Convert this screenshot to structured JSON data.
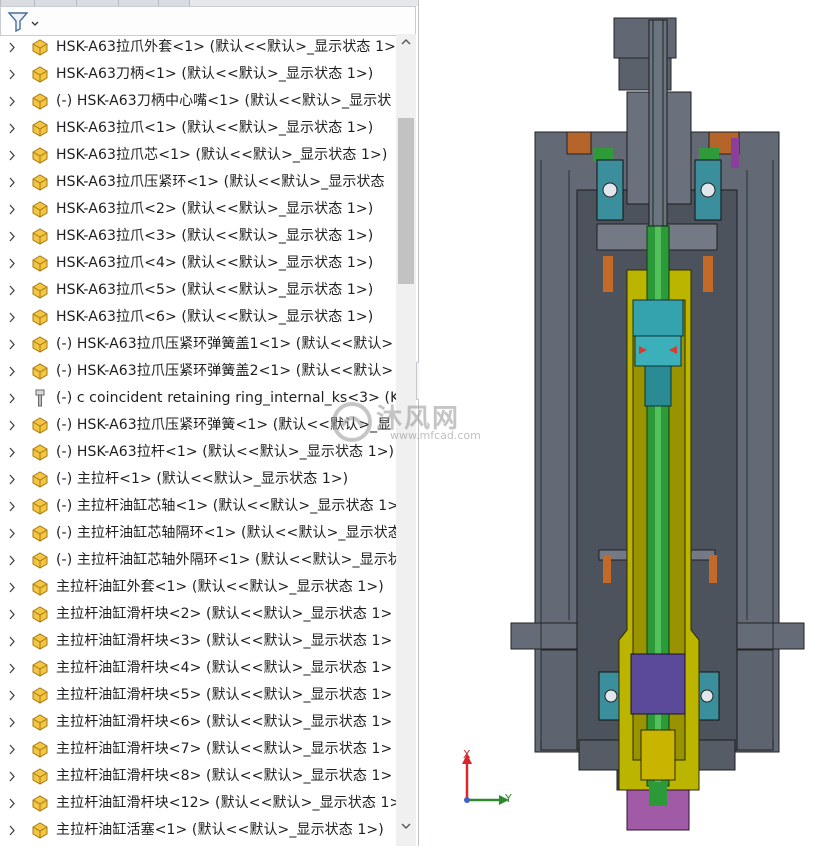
{
  "tree": {
    "filter_tooltip": "",
    "items": [
      {
        "icon": "part-icon",
        "label": "HSK-A63拉爪外套<1> (默认<<默认>_显示状态 1>"
      },
      {
        "icon": "part-icon",
        "label": "HSK-A63刀柄<1> (默认<<默认>_显示状态 1>)"
      },
      {
        "icon": "part-icon",
        "label": "(-) HSK-A63刀柄中心嘴<1> (默认<<默认>_显示状"
      },
      {
        "icon": "part-icon",
        "label": "HSK-A63拉爪<1> (默认<<默认>_显示状态 1>)"
      },
      {
        "icon": "part-icon",
        "label": "HSK-A63拉爪芯<1> (默认<<默认>_显示状态 1>)"
      },
      {
        "icon": "part-icon",
        "label": "HSK-A63拉爪压紧环<1> (默认<<默认>_显示状态"
      },
      {
        "icon": "part-icon",
        "label": "HSK-A63拉爪<2> (默认<<默认>_显示状态 1>)"
      },
      {
        "icon": "part-icon",
        "label": "HSK-A63拉爪<3> (默认<<默认>_显示状态 1>)"
      },
      {
        "icon": "part-icon",
        "label": "HSK-A63拉爪<4> (默认<<默认>_显示状态 1>)"
      },
      {
        "icon": "part-icon",
        "label": "HSK-A63拉爪<5> (默认<<默认>_显示状态 1>)"
      },
      {
        "icon": "part-icon",
        "label": "HSK-A63拉爪<6> (默认<<默认>_显示状态 1>)"
      },
      {
        "icon": "part-icon",
        "label": "(-) HSK-A63拉爪压紧环弹簧盖1<1> (默认<<默认>"
      },
      {
        "icon": "part-icon",
        "label": "(-) HSK-A63拉爪压紧环弹簧盖2<1> (默认<<默认>"
      },
      {
        "icon": "toolbox-part-icon",
        "label": "(-) c coincident retaining ring_internal_ks<3> (KS"
      },
      {
        "icon": "part-icon",
        "label": "(-) HSK-A63拉爪压紧环弹簧<1> (默认<<默认>_显"
      },
      {
        "icon": "part-icon",
        "label": "(-) HSK-A63拉杆<1> (默认<<默认>_显示状态 1>)"
      },
      {
        "icon": "part-icon",
        "label": "(-) 主拉杆<1> (默认<<默认>_显示状态 1>)"
      },
      {
        "icon": "part-icon",
        "label": "(-) 主拉杆油缸芯轴<1> (默认<<默认>_显示状态 1>"
      },
      {
        "icon": "part-icon",
        "label": "(-) 主拉杆油缸芯轴隔环<1> (默认<<默认>_显示状态"
      },
      {
        "icon": "part-icon",
        "label": "(-) 主拉杆油缸芯轴外隔环<1> (默认<<默认>_显示状"
      },
      {
        "icon": "part-icon",
        "label": "主拉杆油缸外套<1> (默认<<默认>_显示状态 1>)"
      },
      {
        "icon": "part-icon",
        "label": "主拉杆油缸滑杆块<2> (默认<<默认>_显示状态 1>"
      },
      {
        "icon": "part-icon",
        "label": "主拉杆油缸滑杆块<3> (默认<<默认>_显示状态 1>"
      },
      {
        "icon": "part-icon",
        "label": "主拉杆油缸滑杆块<4> (默认<<默认>_显示状态 1>"
      },
      {
        "icon": "part-icon",
        "label": "主拉杆油缸滑杆块<5> (默认<<默认>_显示状态 1>"
      },
      {
        "icon": "part-icon",
        "label": "主拉杆油缸滑杆块<6> (默认<<默认>_显示状态 1>"
      },
      {
        "icon": "part-icon",
        "label": "主拉杆油缸滑杆块<7> (默认<<默认>_显示状态 1>"
      },
      {
        "icon": "part-icon",
        "label": "主拉杆油缸滑杆块<8> (默认<<默认>_显示状态 1>"
      },
      {
        "icon": "part-icon",
        "label": "主拉杆油缸滑杆块<12> (默认<<默认>_显示状态 1>"
      },
      {
        "icon": "part-icon",
        "label": "主拉杆油缸活塞<1> (默认<<默认>_显示状态 1>)"
      }
    ]
  },
  "scrollbar": {
    "up": "^",
    "down": "v"
  },
  "collapse_handle": "<",
  "watermark": {
    "text": "沐风网",
    "url": "www.mfcad.com"
  },
  "triad": {
    "x_label": "X",
    "y_label": "Y",
    "x_color": "#d9262b",
    "y_color": "#2f8a2f"
  },
  "colors": {
    "housing": "#5f6570",
    "spindle_yellow": "#c8c100",
    "drawbar_green": "#2f9c3a",
    "collet_cyan": "#3aa6b0",
    "copper": "#c36a28",
    "purple": "#8c5a96"
  }
}
